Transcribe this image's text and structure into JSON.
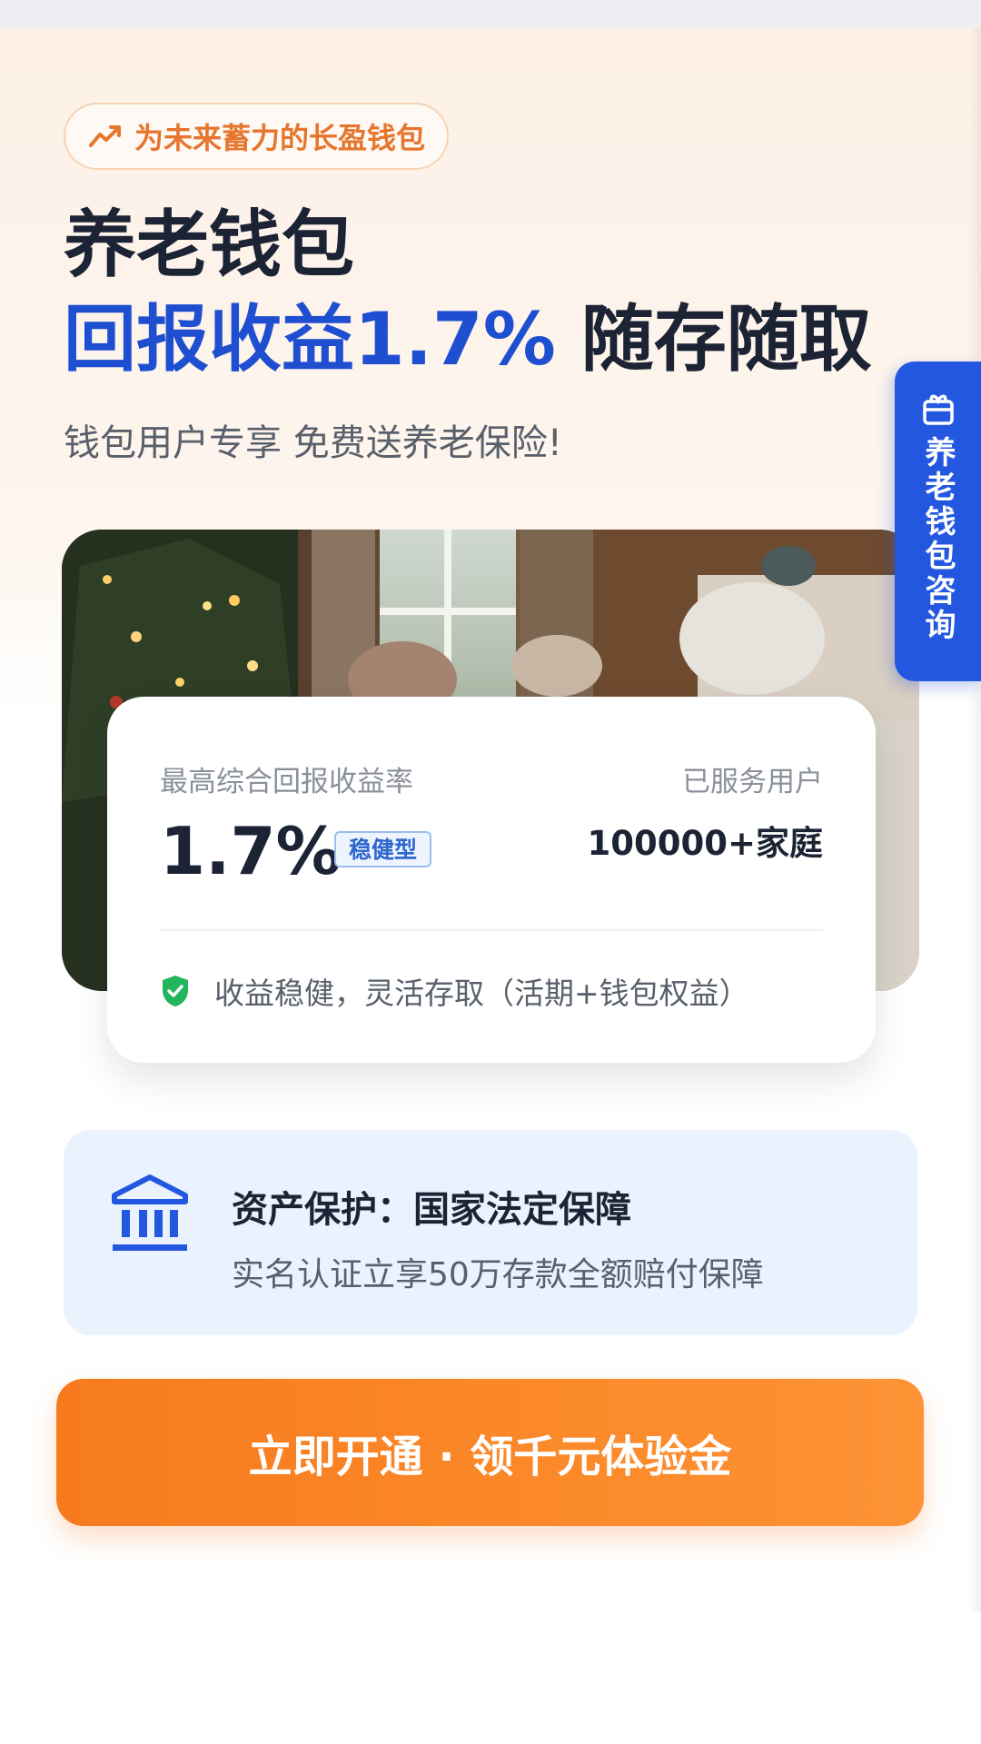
{
  "tag": {
    "label": "为未来蓄力的长盈钱包",
    "icon": "trend-up-icon"
  },
  "hero": {
    "title": "养老钱包",
    "highlight": "回报收益1.7%",
    "title_suffix": "随存随取",
    "subtitle": "钱包用户专享 免费送养老保险!"
  },
  "side_tab": {
    "label": "养老钱包咨询",
    "icon": "gift-icon"
  },
  "stats": {
    "rate_label": "最高综合回报收益率",
    "rate_value": "1.7%",
    "rate_badge": "稳健型",
    "users_label": "已服务用户",
    "users_value": "100000+家庭",
    "note": "收益稳健，灵活存取（活期+钱包权益）",
    "note_icon": "shield-check-icon"
  },
  "protection": {
    "icon": "bank-icon",
    "title": "资产保护：国家法定保障",
    "description": "实名认证立享50万存款全额赔付保障"
  },
  "cta": {
    "label": "立即开通 · 领千元体验金"
  },
  "colors": {
    "brand_blue": "#1f4fd1",
    "accent_orange": "#f77a1e",
    "shield_green": "#22b55b"
  }
}
